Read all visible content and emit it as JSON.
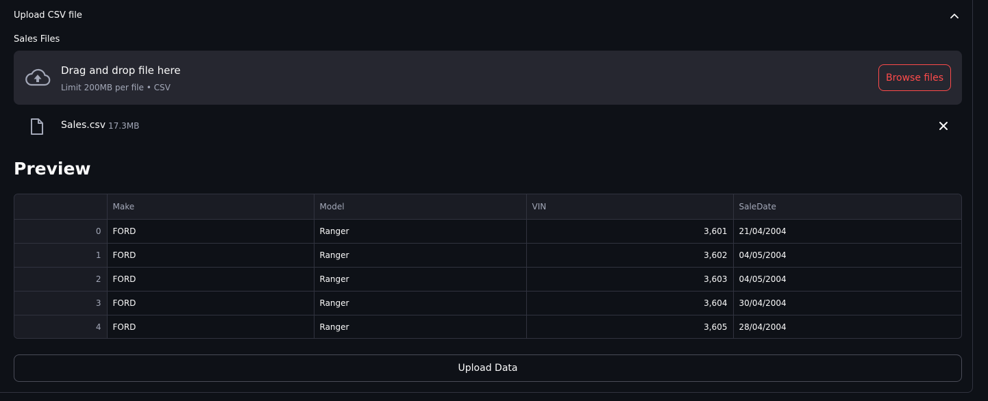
{
  "expander": {
    "title": "Upload CSV file"
  },
  "uploader": {
    "label": "Sales Files",
    "drop_text": "Drag and drop file here",
    "limit_text": "Limit 200MB per file • CSV",
    "browse_label": "Browse files",
    "icon": "cloud-upload-icon"
  },
  "file": {
    "name": "Sales.csv",
    "size": "17.3MB",
    "icon": "file-icon"
  },
  "preview": {
    "heading": "Preview",
    "columns": [
      "",
      "Make",
      "Model",
      "VIN",
      "SaleDate"
    ],
    "rows": [
      {
        "index": "0",
        "make": "FORD",
        "model": "Ranger",
        "vin": "3,601",
        "sale_date": "21/04/2004"
      },
      {
        "index": "1",
        "make": "FORD",
        "model": "Ranger",
        "vin": "3,602",
        "sale_date": "04/05/2004"
      },
      {
        "index": "2",
        "make": "FORD",
        "model": "Ranger",
        "vin": "3,603",
        "sale_date": "04/05/2004"
      },
      {
        "index": "3",
        "make": "FORD",
        "model": "Ranger",
        "vin": "3,604",
        "sale_date": "30/04/2004"
      },
      {
        "index": "4",
        "make": "FORD",
        "model": "Ranger",
        "vin": "3,605",
        "sale_date": "28/04/2004"
      }
    ]
  },
  "actions": {
    "upload_label": "Upload Data"
  },
  "colors": {
    "background": "#0e1117",
    "dropzone": "#262730",
    "accent": "#ff4b4b",
    "border": "#31333f",
    "muted_text": "#a3a8b8"
  }
}
